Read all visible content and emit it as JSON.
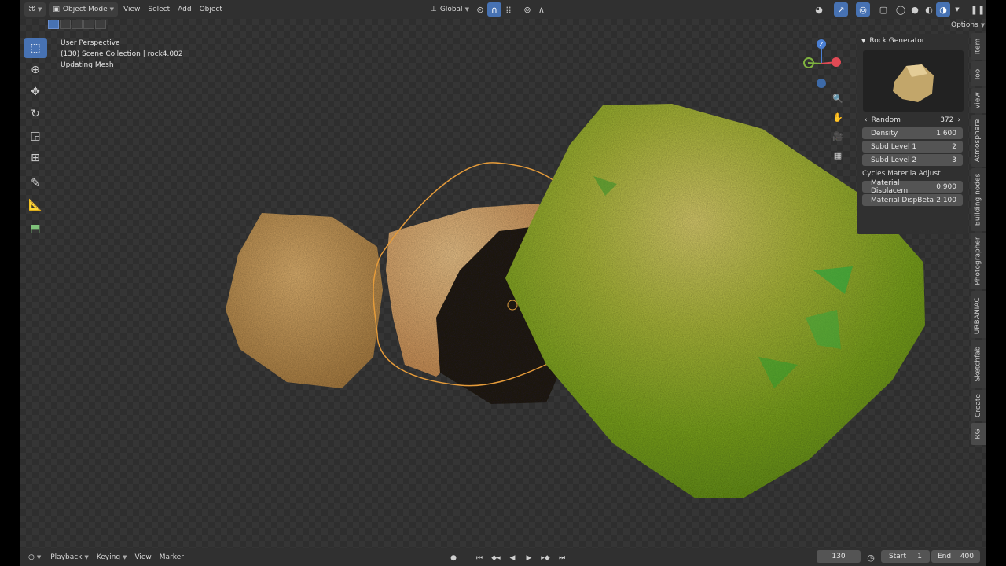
{
  "header": {
    "mode": "Object Mode",
    "menus": [
      "View",
      "Select",
      "Add",
      "Object"
    ],
    "orientation": "Global",
    "options_label": "Options"
  },
  "viewport": {
    "perspective": "User Perspective",
    "collection": "(130) Scene Collection | rock4.002",
    "status": "Updating Mesh"
  },
  "panel": {
    "title": "Rock Generator",
    "random_label": "Random",
    "random_value": "372",
    "fields": [
      {
        "label": "Density",
        "value": "1.600"
      },
      {
        "label": "Subd Level 1",
        "value": "2"
      },
      {
        "label": "Subd Level 2",
        "value": "3"
      }
    ],
    "subsection": "Cycles Materila Adjust",
    "material_fields": [
      {
        "label": "Material Displacem",
        "value": "0.900"
      },
      {
        "label": "Material DispBeta",
        "value": "2.100"
      }
    ]
  },
  "tabs": [
    "Item",
    "Tool",
    "View",
    "Atmosphere",
    "Building nodes",
    "Photographer",
    "URBANIAC!",
    "Sketchfab",
    "Create",
    "RG"
  ],
  "active_tab": "RG",
  "gizmo": {
    "z": "Z"
  },
  "timeline": {
    "menus": [
      "Playback",
      "Keying",
      "View",
      "Marker"
    ],
    "current_frame": "130",
    "start_label": "Start",
    "start_value": "1",
    "end_label": "End",
    "end_value": "400"
  },
  "colors": {
    "accent": "#4772b3",
    "selection_outline": "#e59b3a",
    "x_axis": "#e14a55",
    "y_axis": "#7fb33f",
    "z_axis": "#4a7fd4"
  }
}
